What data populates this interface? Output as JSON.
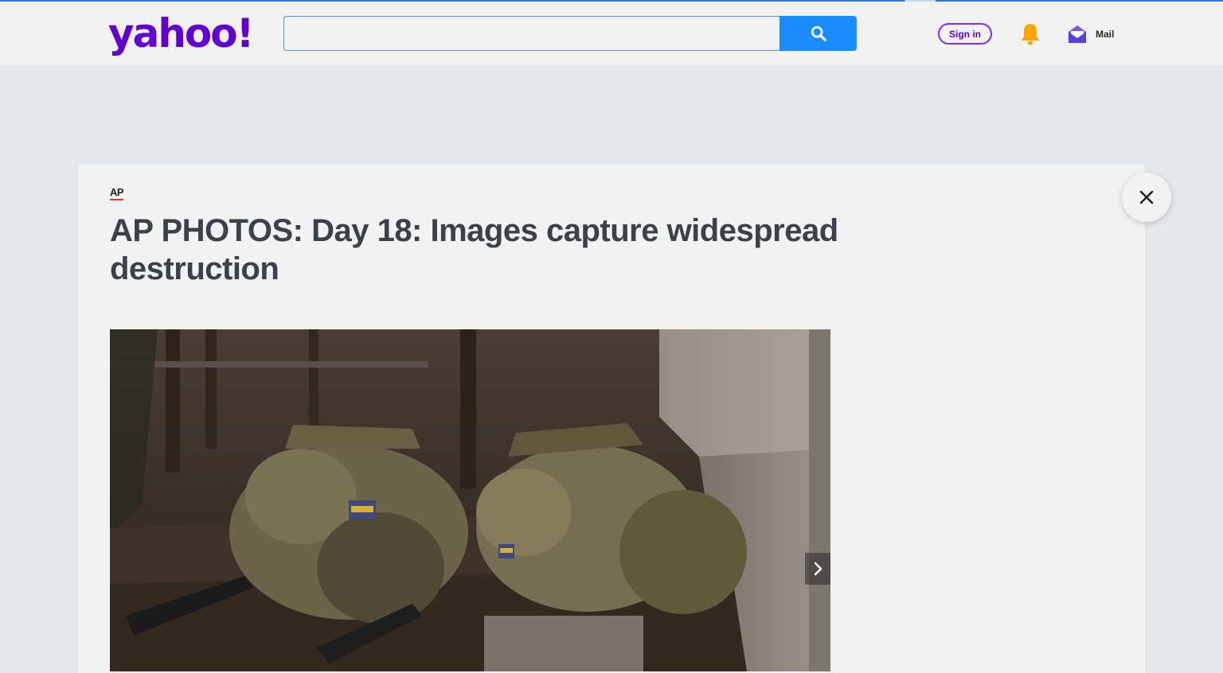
{
  "header": {
    "logo_text": "yahoo!",
    "search": {
      "value": "",
      "placeholder": ""
    },
    "signin_label": "Sign in",
    "mail_label": "Mail"
  },
  "article": {
    "provider": "AP",
    "title": "AP PHOTOS: Day 18: Images capture widespread destruction"
  },
  "icons": {
    "search": "search-icon",
    "bell": "bell-icon",
    "mail": "mail-icon",
    "close": "close-icon",
    "next": "chevron-right-icon"
  },
  "colors": {
    "brand": "#6001d2",
    "search_button": "#1a8cff",
    "bell": "#ffa700",
    "provider_underline": "#e5342a"
  }
}
